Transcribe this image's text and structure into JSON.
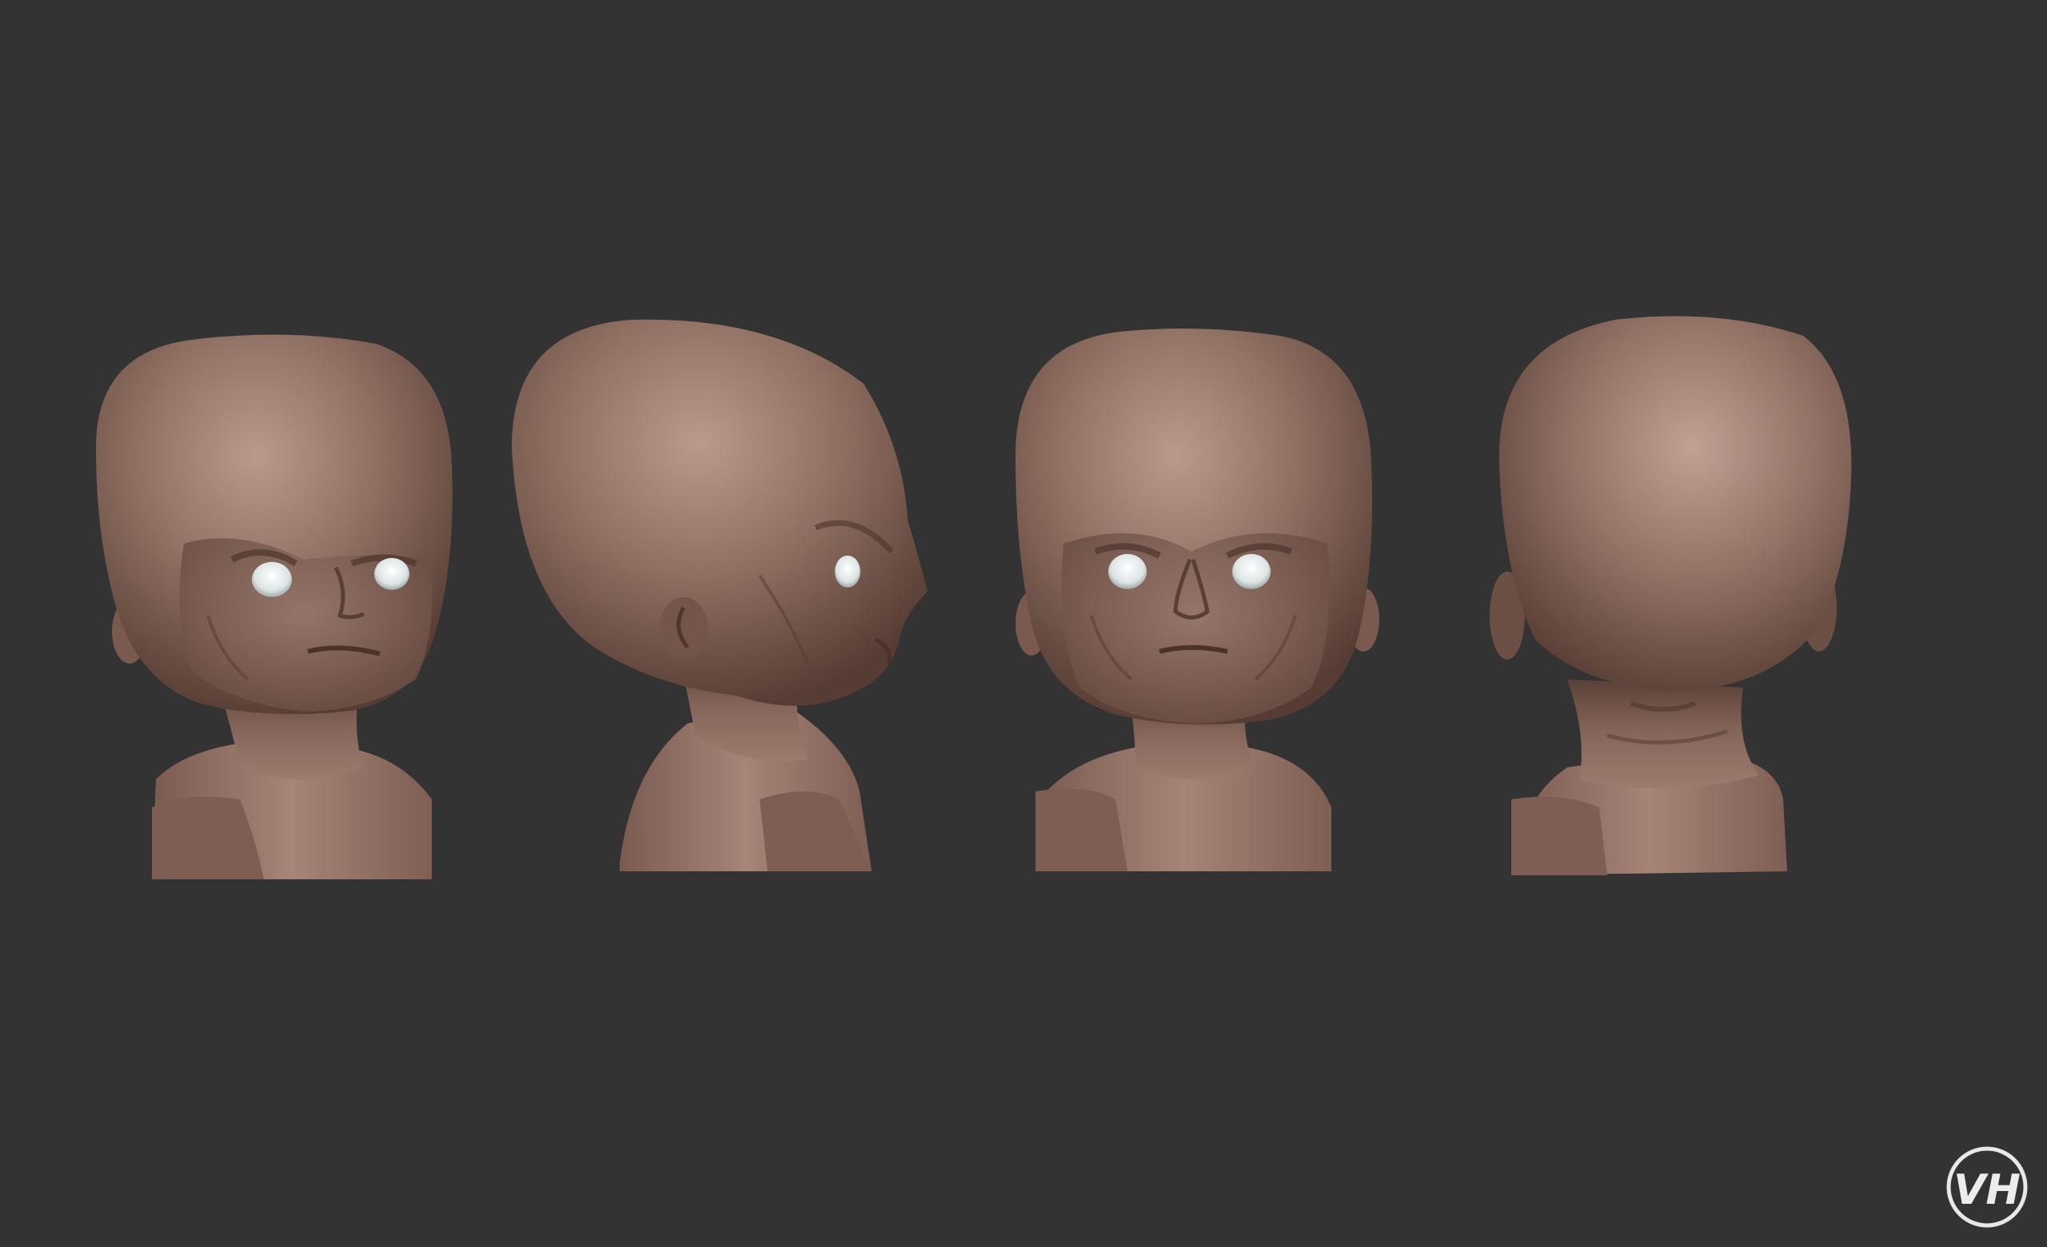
{
  "scene": {
    "background": "#333333",
    "skin_base": "#8a6a5c",
    "skin_light": "#b7968a",
    "skin_dark": "#4e3730",
    "eye_color": "#e6ecec",
    "cut_color": "#7e5e52"
  },
  "views": [
    {
      "name": "three-quarter-front"
    },
    {
      "name": "side-profile"
    },
    {
      "name": "front"
    },
    {
      "name": "back"
    }
  ],
  "watermark": {
    "icon": "vh-monogram-logo",
    "text": "VH"
  }
}
